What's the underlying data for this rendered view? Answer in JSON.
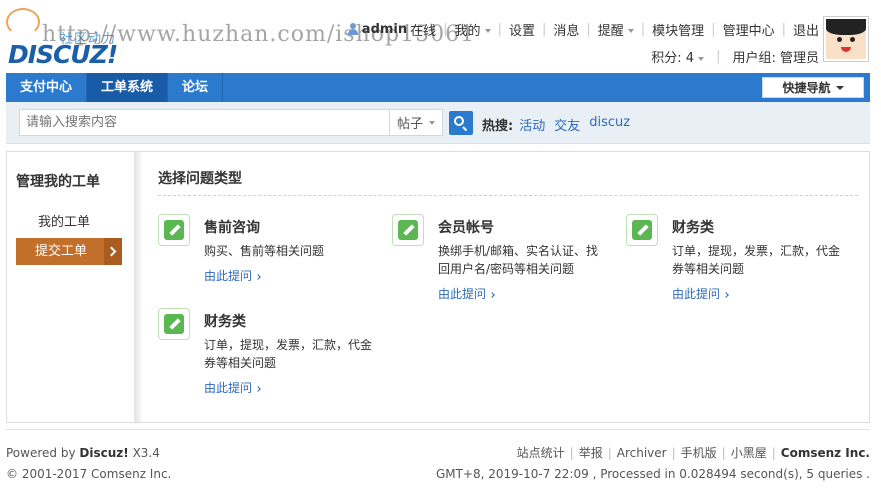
{
  "header": {
    "slogan": "社区动力",
    "brand": "DISCUZ!",
    "watermark": "http://www.huzhan.com/ishop15061",
    "username": "admin",
    "online": "在线",
    "top_links": [
      "我的",
      "设置",
      "消息",
      "提醒",
      "模块管理",
      "管理中心",
      "退出"
    ],
    "credits": "积分: 4",
    "usergroup": "用户组: 管理员"
  },
  "navbar": {
    "tabs": [
      "支付中心",
      "工单系统",
      "论坛"
    ],
    "active_tab": 1,
    "quick_nav": "快捷导航"
  },
  "search": {
    "placeholder": "请输入搜索内容",
    "type": "帖子",
    "hot_label": "热搜:",
    "hot_keywords": [
      "活动",
      "交友",
      "discuz"
    ]
  },
  "sidebar": {
    "title": "管理我的工单",
    "my_tickets": "我的工单",
    "submit": "提交工单"
  },
  "main": {
    "title": "选择问题类型",
    "cards": [
      {
        "name": "售前咨询",
        "desc": "购买、售前等相关问题",
        "link": "由此提问"
      },
      {
        "name": "会员帐号",
        "desc": "换绑手机/邮箱、实名认证、找回用户名/密码等相关问题",
        "link": "由此提问"
      },
      {
        "name": "财务类",
        "desc": "订单，提现，发票，汇款，代金券等相关问题",
        "link": "由此提问"
      },
      {
        "name": "财务类",
        "desc": "订单，提现，发票，汇款，代金券等相关问题",
        "link": "由此提问"
      }
    ]
  },
  "footer": {
    "powered_prefix": "Powered by",
    "powered_brand": "Discuz!",
    "version": "X3.4",
    "copyright": "© 2001-2017 Comsenz Inc.",
    "links": [
      "站点统计",
      "举报",
      "Archiver",
      "手机版",
      "小黑屋"
    ],
    "company": "Comsenz Inc.",
    "processed": "GMT+8, 2019-10-7 22:09 , Processed in 0.028494 second(s), 5 queries ."
  }
}
